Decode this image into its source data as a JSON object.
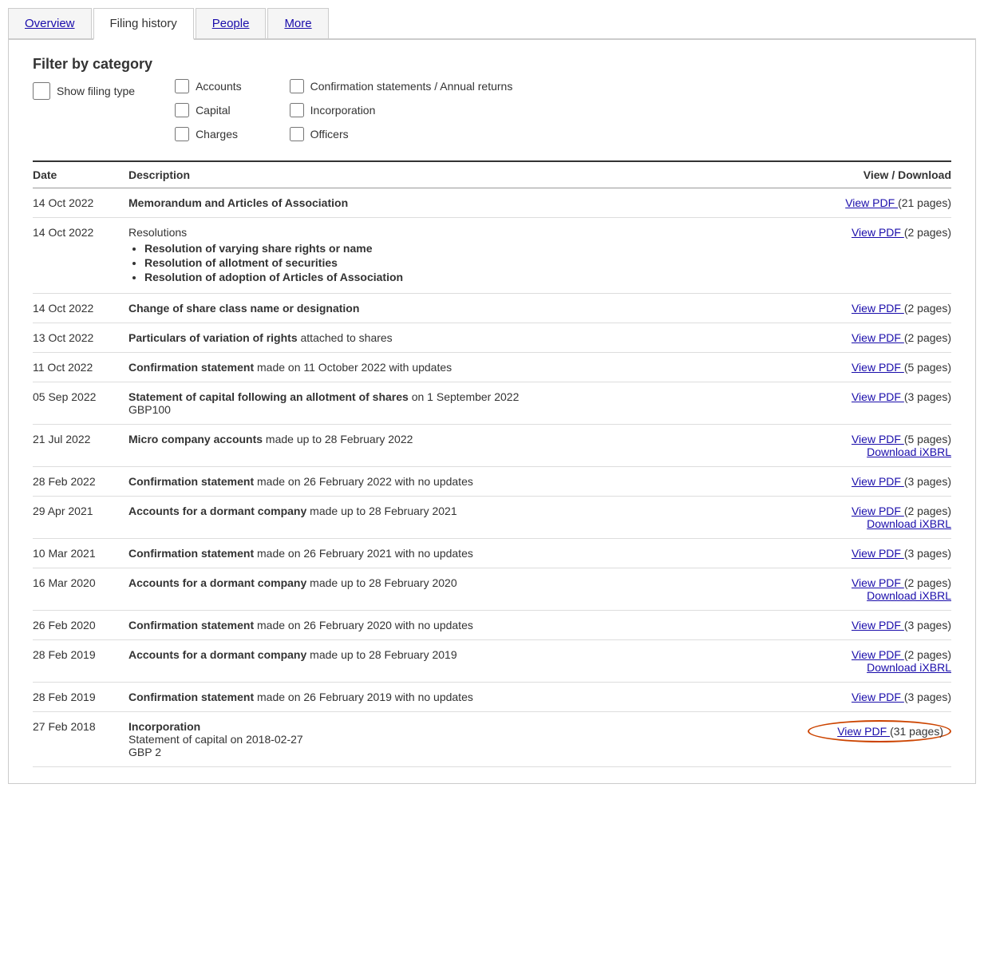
{
  "tabs": [
    {
      "label": "Overview",
      "active": false
    },
    {
      "label": "Filing history",
      "active": true
    },
    {
      "label": "People",
      "active": false
    },
    {
      "label": "More",
      "active": false
    }
  ],
  "filter": {
    "title": "Filter by category",
    "show_filing_type_label": "Show filing type",
    "checkboxes_col1": [
      "Accounts",
      "Capital",
      "Charges"
    ],
    "checkboxes_col2": [
      "Confirmation statements / Annual returns",
      "Incorporation",
      "Officers"
    ]
  },
  "table": {
    "headers": [
      "Date",
      "Description",
      "View / Download"
    ],
    "rows": [
      {
        "date": "14 Oct 2022",
        "description_bold": "Memorandum and Articles of Association",
        "description_rest": "",
        "description_extra": null,
        "view_links": [
          {
            "text": "View PDF ",
            "suffix": "(21 pages)",
            "circled": false
          }
        ]
      },
      {
        "date": "14 Oct 2022",
        "description_bold": null,
        "description_rest": "",
        "description_label": "Resolutions",
        "description_bullets": [
          "Resolution of varying share rights or name",
          "Resolution of allotment of securities",
          "Resolution of adoption of Articles of Association"
        ],
        "view_links": [
          {
            "text": "View PDF ",
            "suffix": "(2 pages)",
            "circled": false
          }
        ]
      },
      {
        "date": "14 Oct 2022",
        "description_bold": "Change of share class name or designation",
        "description_rest": "",
        "view_links": [
          {
            "text": "View PDF ",
            "suffix": "(2 pages)",
            "circled": false
          }
        ]
      },
      {
        "date": "13 Oct 2022",
        "description_bold": "Particulars of variation of rights",
        "description_rest": " attached to shares",
        "view_links": [
          {
            "text": "View PDF ",
            "suffix": "(2 pages)",
            "circled": false
          }
        ]
      },
      {
        "date": "11 Oct 2022",
        "description_bold": "Confirmation statement",
        "description_rest": " made on 11 October 2022 with updates",
        "view_links": [
          {
            "text": "View PDF ",
            "suffix": "(5 pages)",
            "circled": false
          }
        ]
      },
      {
        "date": "05 Sep 2022",
        "description_bold": "Statement of capital following an allotment of shares",
        "description_rest": " on 1 September 2022\nGBP100",
        "view_links": [
          {
            "text": "View PDF ",
            "suffix": "(3 pages)",
            "circled": false
          }
        ]
      },
      {
        "date": "21 Jul 2022",
        "description_bold": "Micro company accounts",
        "description_rest": " made up to 28 February 2022",
        "view_links": [
          {
            "text": "View PDF ",
            "suffix": "(5 pages)",
            "circled": false
          },
          {
            "text": "Download iXBRL",
            "suffix": "",
            "circled": false
          }
        ]
      },
      {
        "date": "28 Feb 2022",
        "description_bold": "Confirmation statement",
        "description_rest": " made on 26 February 2022 with no updates",
        "view_links": [
          {
            "text": "View PDF ",
            "suffix": "(3 pages)",
            "circled": false
          }
        ]
      },
      {
        "date": "29 Apr 2021",
        "description_bold": "Accounts for a dormant company",
        "description_rest": " made up to 28 February 2021",
        "view_links": [
          {
            "text": "View PDF ",
            "suffix": "(2 pages)",
            "circled": false
          },
          {
            "text": "Download iXBRL",
            "suffix": "",
            "circled": false
          }
        ]
      },
      {
        "date": "10 Mar 2021",
        "description_bold": "Confirmation statement",
        "description_rest": " made on 26 February 2021 with no updates",
        "view_links": [
          {
            "text": "View PDF ",
            "suffix": "(3 pages)",
            "circled": false
          }
        ]
      },
      {
        "date": "16 Mar 2020",
        "description_bold": "Accounts for a dormant company",
        "description_rest": " made up to 28 February 2020",
        "view_links": [
          {
            "text": "View PDF ",
            "suffix": "(2 pages)",
            "circled": false
          },
          {
            "text": "Download iXBRL",
            "suffix": "",
            "circled": false
          }
        ]
      },
      {
        "date": "26 Feb 2020",
        "description_bold": "Confirmation statement",
        "description_rest": " made on 26 February 2020 with no updates",
        "view_links": [
          {
            "text": "View PDF ",
            "suffix": "(3 pages)",
            "circled": false
          }
        ]
      },
      {
        "date": "28 Feb 2019",
        "description_bold": "Accounts for a dormant company",
        "description_rest": " made up to 28 February 2019",
        "view_links": [
          {
            "text": "View PDF ",
            "suffix": "(2 pages)",
            "circled": false
          },
          {
            "text": "Download iXBRL",
            "suffix": "",
            "circled": false
          }
        ]
      },
      {
        "date": "28 Feb 2019",
        "description_bold": "Confirmation statement",
        "description_rest": " made on 26 February 2019 with no updates",
        "view_links": [
          {
            "text": "View PDF ",
            "suffix": "(3 pages)",
            "circled": false
          }
        ]
      },
      {
        "date": "27 Feb 2018",
        "description_label2": "Incorporation",
        "description_rest2": "Statement of capital on 2018-02-27\nGBP 2",
        "view_links": [
          {
            "text": "View PDF ",
            "suffix": "(31 pages)",
            "circled": true
          }
        ]
      }
    ]
  }
}
